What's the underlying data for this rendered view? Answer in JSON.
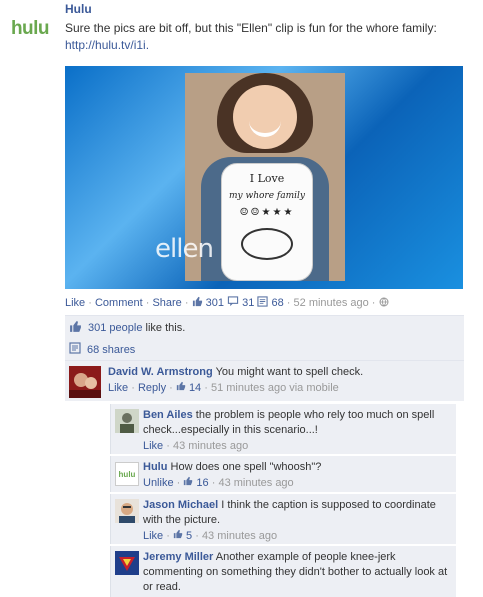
{
  "post": {
    "author": "Hulu",
    "avatar_text": "hulu",
    "text": "Sure the pics are bit off, but this \"Ellen\" clip is fun for the whore family:",
    "link": "http://hulu.tv/i1i.",
    "video": {
      "sign_line1": "I  Love",
      "sign_line2": "my whore family",
      "sign_line3": "☺☺★★★",
      "watermark": "ellen"
    },
    "actions": {
      "like": "Like",
      "comment": "Comment",
      "share": "Share",
      "like_count": "301",
      "comment_count": "31",
      "share_count": "68",
      "timestamp": "52 minutes ago"
    }
  },
  "likes_summary": {
    "count_text": "301 people",
    "suffix": "like this."
  },
  "shares_summary": {
    "text": "68 shares"
  },
  "comments": [
    {
      "name": "David W. Armstrong",
      "text": "You might want to spell check.",
      "like": "Like",
      "reply": "Reply",
      "likes": "14",
      "time": "51 minutes ago via mobile"
    }
  ],
  "replies": [
    {
      "name": "Ben Ailes",
      "text": "the problem is people who rely too much on spell check...especially in this scenario...!",
      "like": "Like",
      "time": "43 minutes ago"
    },
    {
      "name": "Hulu",
      "avatar_text": "hulu",
      "text": "How does one spell \"whoosh\"?",
      "like": "Unlike",
      "likes": "16",
      "time": "43 minutes ago"
    },
    {
      "name": "Jason Michael",
      "text": "I think the caption is supposed to coordinate with the picture.",
      "like": "Like",
      "likes": "5",
      "time": "43 minutes ago"
    },
    {
      "name": "Jeremy Miller",
      "text": "Another example of people knee-jerk commenting on something they didn't bother to actually look at or read."
    }
  ],
  "colors": {
    "link": "#3b5998",
    "stream_bg": "#edeff4",
    "brand_green": "#6aa84f"
  }
}
